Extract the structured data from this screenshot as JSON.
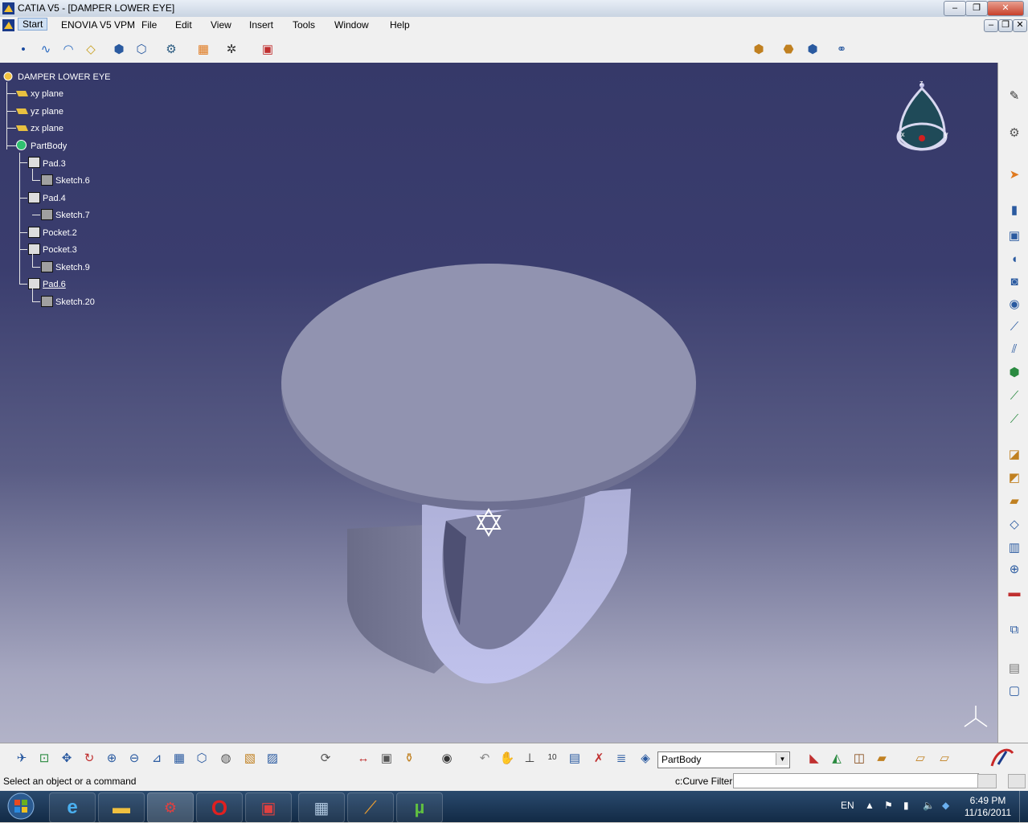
{
  "window": {
    "title": "CATIA V5 - [DAMPER LOWER EYE]",
    "min": "–",
    "restore": "❐",
    "close": "✕"
  },
  "menu": {
    "items": [
      "Start",
      "ENOVIA V5 VPM",
      "File",
      "Edit",
      "View",
      "Insert",
      "Tools",
      "Window",
      "Help"
    ]
  },
  "tree": {
    "root": "DAMPER LOWER EYE",
    "planes": [
      "xy plane",
      "yz plane",
      "zx plane"
    ],
    "body": "PartBody",
    "features": [
      {
        "label": "Pad.3",
        "sketch": "Sketch.6"
      },
      {
        "label": "Pad.4",
        "sketch": "Sketch.7"
      },
      {
        "label": "Pocket.2",
        "sketch": ""
      },
      {
        "label": "Pocket.3",
        "sketch": "Sketch.9"
      },
      {
        "label": "Pad.6",
        "sketch": "Sketch.20"
      }
    ]
  },
  "compass": {
    "x": "x",
    "y": "y",
    "z": "z"
  },
  "bottom_toolbar": {
    "current_body": "PartBody"
  },
  "status": {
    "message": "Select an object or a command",
    "filter_label": "c:Curve Filter",
    "command_value": ""
  },
  "taskbar": {
    "language": "EN",
    "time": "6:49 PM",
    "date": "11/16/2011"
  },
  "colors": {
    "viewport_top": "#363969",
    "viewport_bottom": "#b2b3c8",
    "part_face": "#9193b0",
    "part_side": "#b8b9dc"
  },
  "icons": [
    "undo-icon",
    "save-icon",
    "search-icon"
  ]
}
